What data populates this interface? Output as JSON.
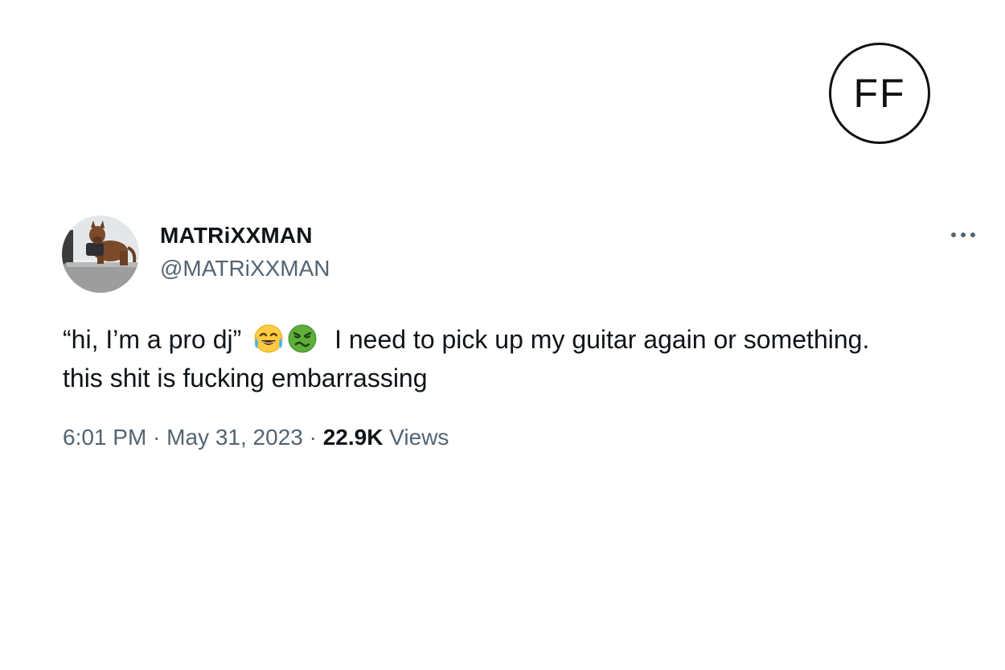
{
  "logo": {
    "text": "FF"
  },
  "tweet": {
    "author": {
      "display_name": "MATRiXXMAN",
      "handle": "@MATRiXXMAN",
      "avatar_icon": "dog-avatar"
    },
    "menu_icon": "more-options-icon",
    "text_part1": "“hi, I’m a pro dj”",
    "emojis": [
      "face-with-tears-of-joy-emoji",
      "nauseated-face-emoji"
    ],
    "text_part2": "I need to pick up my guitar again or something.",
    "text_part3": "this shit is fucking embarrassing",
    "time": "6:01 PM",
    "separator": "·",
    "date": "May 31, 2023",
    "views_count": "22.9K",
    "views_label": "Views"
  },
  "colors": {
    "text_primary": "#0f1419",
    "text_secondary": "#536471",
    "background": "#ffffff"
  }
}
